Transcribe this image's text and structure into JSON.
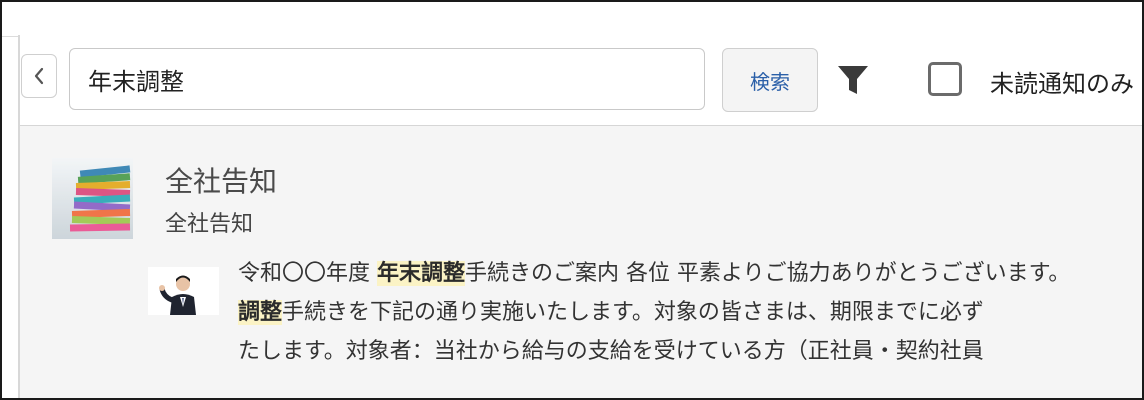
{
  "toolbar": {
    "search_value": "年末調整",
    "search_button_label": "検索",
    "unread_only_label": "未読通知のみ"
  },
  "notice": {
    "channel_title": "全社告知",
    "channel_subtitle": "全社告知",
    "lines": [
      [
        {
          "text": "令和〇〇年度 ",
          "hl": false
        },
        {
          "text": "年末調整",
          "hl": true
        },
        {
          "text": "手続きのご案内 各位 平素よりご協力ありがとうございます。",
          "hl": false
        }
      ],
      [
        {
          "text": "調整",
          "hl": true
        },
        {
          "text": "手続きを下記の通り実施いたします。対象の皆さまは、期限までに必ず",
          "hl": false
        }
      ],
      [
        {
          "text": "たします。対象者：当社から給与の支給を受けている方（正社員・契約社員",
          "hl": false
        }
      ]
    ]
  },
  "colors": {
    "highlight": "#fbf3c5",
    "search_button_text": "#2a5fa8",
    "content_background": "#f5f5f5",
    "frame_border": "#1a1a1a"
  },
  "icons": {
    "back": "chevron-left-icon",
    "filter": "funnel-icon",
    "checkbox": "checkbox-unchecked"
  }
}
